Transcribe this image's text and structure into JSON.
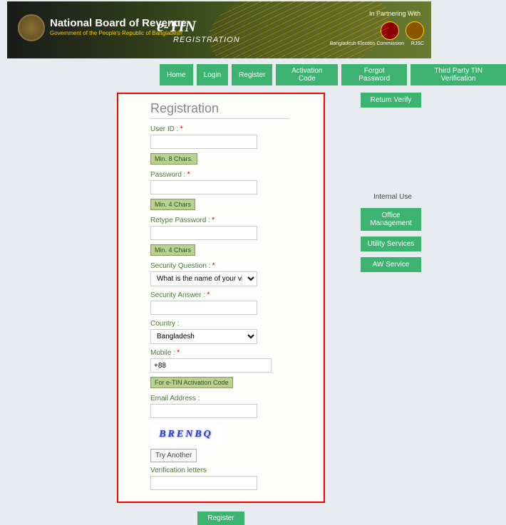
{
  "banner": {
    "title": "National Board of Revenue",
    "subtitle": "Government of the People's Republic of Bangladesh",
    "etin": "e-TIN",
    "registration": "REGISTRATION",
    "partner_label": "In Partnering With",
    "partner1": "Bangladesh Election Commission",
    "partner2": "RJSC"
  },
  "nav": {
    "home": "Home",
    "login": "Login",
    "register": "Register",
    "activation": "Activation Code",
    "forgot": "Forgot Password",
    "thirdparty": "Third Party TIN Verification"
  },
  "form": {
    "title": "Registration",
    "userid_label": "User ID :",
    "userid_hint": "Min. 8 Chars.",
    "password_label": "Password :",
    "password_hint": "Min. 4 Chars",
    "retype_label": "Retype Password :",
    "retype_hint": "Min. 4 Chars",
    "secq_label": "Security Question :",
    "secq_value": "What is the name of your village?",
    "seca_label": "Security Answer :",
    "country_label": "Country :",
    "country_value": "Bangladesh",
    "mobile_label": "Mobile :",
    "mobile_value": "+88",
    "mobile_hint": "For e-TIN Activation Code",
    "email_label": "Email Address :",
    "captcha_text": "BRENBQ",
    "try_another": "Try Another",
    "verif_label": "Verification letters",
    "submit": "Register"
  },
  "right": {
    "return_verify": "Return Verify",
    "internal": "Internal Use",
    "office": "Office Management",
    "utility": "Utility Services",
    "aw": "AW Service"
  }
}
